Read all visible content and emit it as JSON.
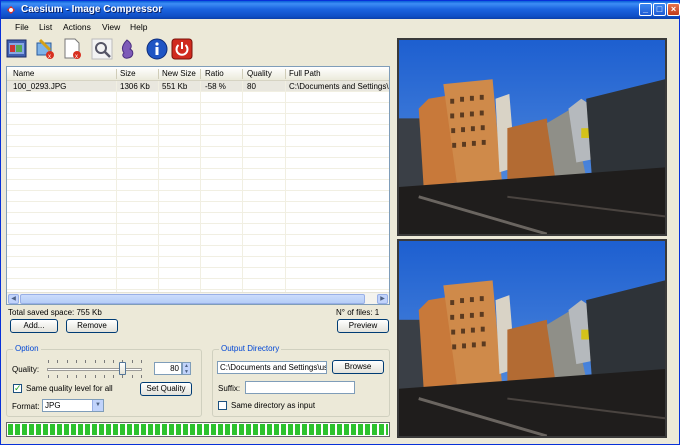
{
  "window": {
    "title": "Caesium - Image Compressor"
  },
  "menu": [
    "File",
    "List",
    "Actions",
    "View",
    "Help"
  ],
  "toolbar_icons": [
    "open-files-icon",
    "remove-item-icon",
    "clear-list-icon",
    "preview-zoom-icon",
    "compress-icon",
    "about-info-icon",
    "exit-power-icon"
  ],
  "table": {
    "columns": [
      "Name",
      "Size",
      "New Size",
      "Ratio",
      "Quality",
      "Full Path"
    ],
    "rows": [
      {
        "name": "100_0293.JPG",
        "size": "1306 Kb",
        "new_size": "551 Kb",
        "ratio": "-58 %",
        "quality": "80",
        "path": "C:\\Documents and Settings\\u..."
      }
    ]
  },
  "status": {
    "saved": "Total saved space: 755 Kb",
    "files": "N° of files: 1"
  },
  "buttons": {
    "add": "Add...",
    "remove": "Remove",
    "preview": "Preview",
    "set_quality": "Set Quality",
    "browse": "Browse"
  },
  "option": {
    "title": "Option",
    "quality_label": "Quality:",
    "quality_value": "80",
    "quality_level": 0.8,
    "same_quality_label": "Same quality level for all",
    "same_quality_checked": true,
    "format_label": "Format:",
    "format_value": "JPG"
  },
  "output": {
    "title": "Output Directory",
    "path": "C:\\Documents and Settings\\us",
    "suffix_label": "Suffix:",
    "suffix_value": "",
    "same_dir_label": "Same directory as input",
    "same_dir_checked": false
  },
  "progress": 1.0,
  "colors": {
    "titlebar": "#0a5fd8",
    "progress": "#2dc22d",
    "group_title": "#0046d5"
  }
}
